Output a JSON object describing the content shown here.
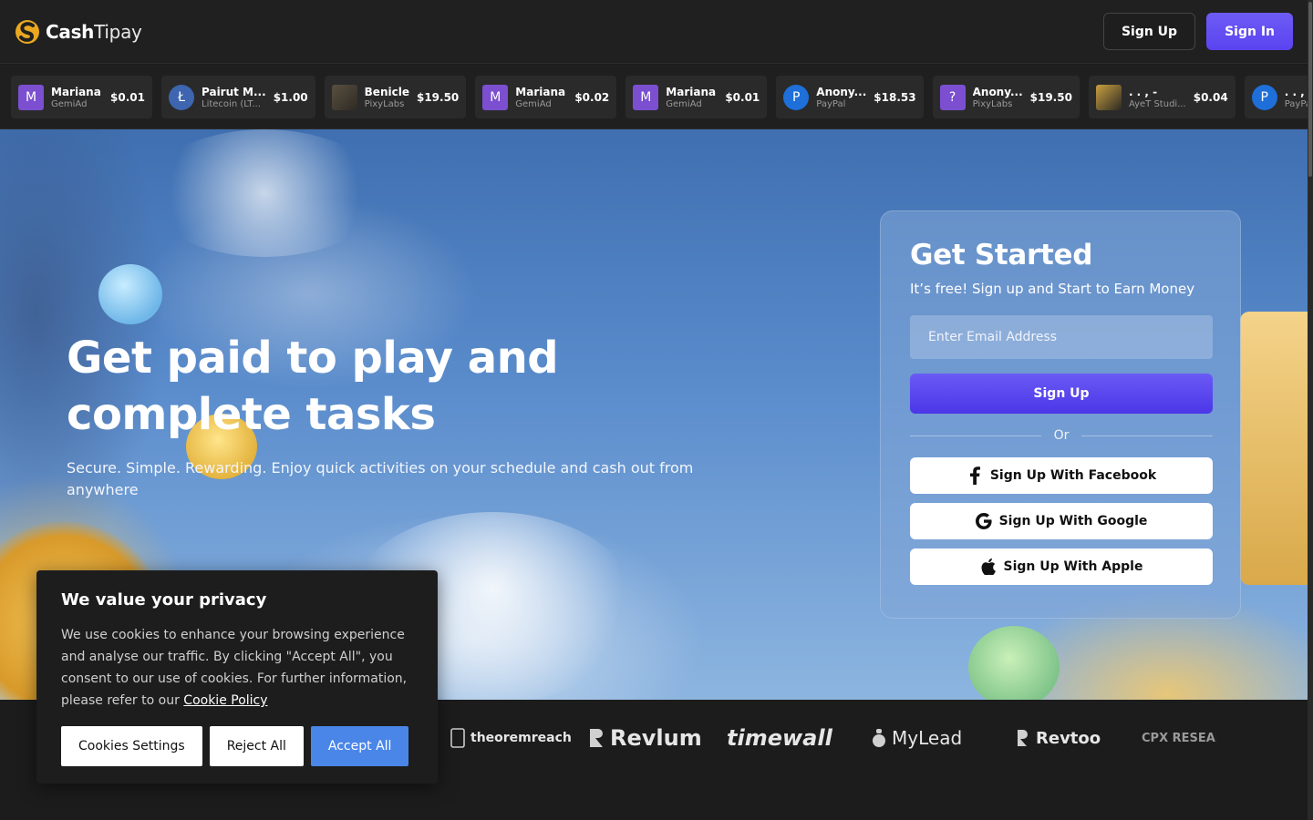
{
  "header": {
    "logo_bold": "Cash",
    "logo_light": "Tipay",
    "signup_label": "Sign Up",
    "signin_label": "Sign In"
  },
  "ticker": [
    {
      "name": "Mariana",
      "source": "GemiAd",
      "amount": "$0.01",
      "avatar_text": "M",
      "avatar_color": "#7b4fd0",
      "icon": "letter-avatar"
    },
    {
      "name": "Pairut M...",
      "source": "Litecoin (LT...",
      "amount": "$1.00",
      "avatar_text": "Ł",
      "avatar_color": "#3d65b0",
      "icon": "litecoin-icon"
    },
    {
      "name": "Benicle",
      "source": "PixyLabs",
      "amount": "$19.50",
      "avatar_text": "",
      "avatar_color": "#5a5040",
      "icon": "game-thumbnail"
    },
    {
      "name": "Mariana",
      "source": "GemiAd",
      "amount": "$0.02",
      "avatar_text": "M",
      "avatar_color": "#7b4fd0",
      "icon": "letter-avatar"
    },
    {
      "name": "Mariana",
      "source": "GemiAd",
      "amount": "$0.01",
      "avatar_text": "M",
      "avatar_color": "#7b4fd0",
      "icon": "letter-avatar"
    },
    {
      "name": "Anony...",
      "source": "PayPal",
      "amount": "$18.53",
      "avatar_text": "P",
      "avatar_color": "#1e6fd9",
      "icon": "paypal-icon"
    },
    {
      "name": "Anony...",
      "source": "PixyLabs",
      "amount": "$19.50",
      "avatar_text": "?",
      "avatar_color": "#7b4fd0",
      "icon": "letter-avatar"
    },
    {
      "name": ". . , -",
      "source": "AyeT Studi...",
      "amount": "$0.04",
      "avatar_text": "",
      "avatar_color": "#c9a040",
      "icon": "game-thumbnail"
    },
    {
      "name": ". . , -",
      "source": "PayPal",
      "amount": "",
      "avatar_text": "P",
      "avatar_color": "#1e6fd9",
      "icon": "paypal-icon"
    }
  ],
  "hero": {
    "title": "Get paid to play and complete tasks",
    "subtitle": "Secure. Simple. Rewarding. Enjoy quick activities on your schedule and cash out from anywhere"
  },
  "signup_card": {
    "title": "Get Started",
    "subtitle": "It’s free! Sign up and Start to Earn Money",
    "email_placeholder": "Enter Email Address",
    "signup_label": "Sign Up",
    "or_label": "Or",
    "facebook_label": "Sign Up With Facebook",
    "google_label": "Sign Up With Google",
    "apple_label": "Sign Up With Apple"
  },
  "partners": {
    "theoremreach": "theoremreach",
    "revlum": "Revlum",
    "timewall": "timewall",
    "mylead": "MyLead",
    "revtoo": "Revtoo",
    "cpx": "CPX RESEARCH"
  },
  "cookie": {
    "title": "We value your privacy",
    "body": "We use cookies to enhance your browsing experience and analyse our traffic. By clicking \"Accept All\", you consent to our use of cookies. For further information, please refer to our",
    "link": "Cookie Policy",
    "settings_label": "Cookies Settings",
    "reject_label": "Reject All",
    "accept_label": "Accept All"
  },
  "colors": {
    "accent": "#5a43ef",
    "cookie_accept": "#4a86e8",
    "logo_gold": "#f0b429"
  }
}
